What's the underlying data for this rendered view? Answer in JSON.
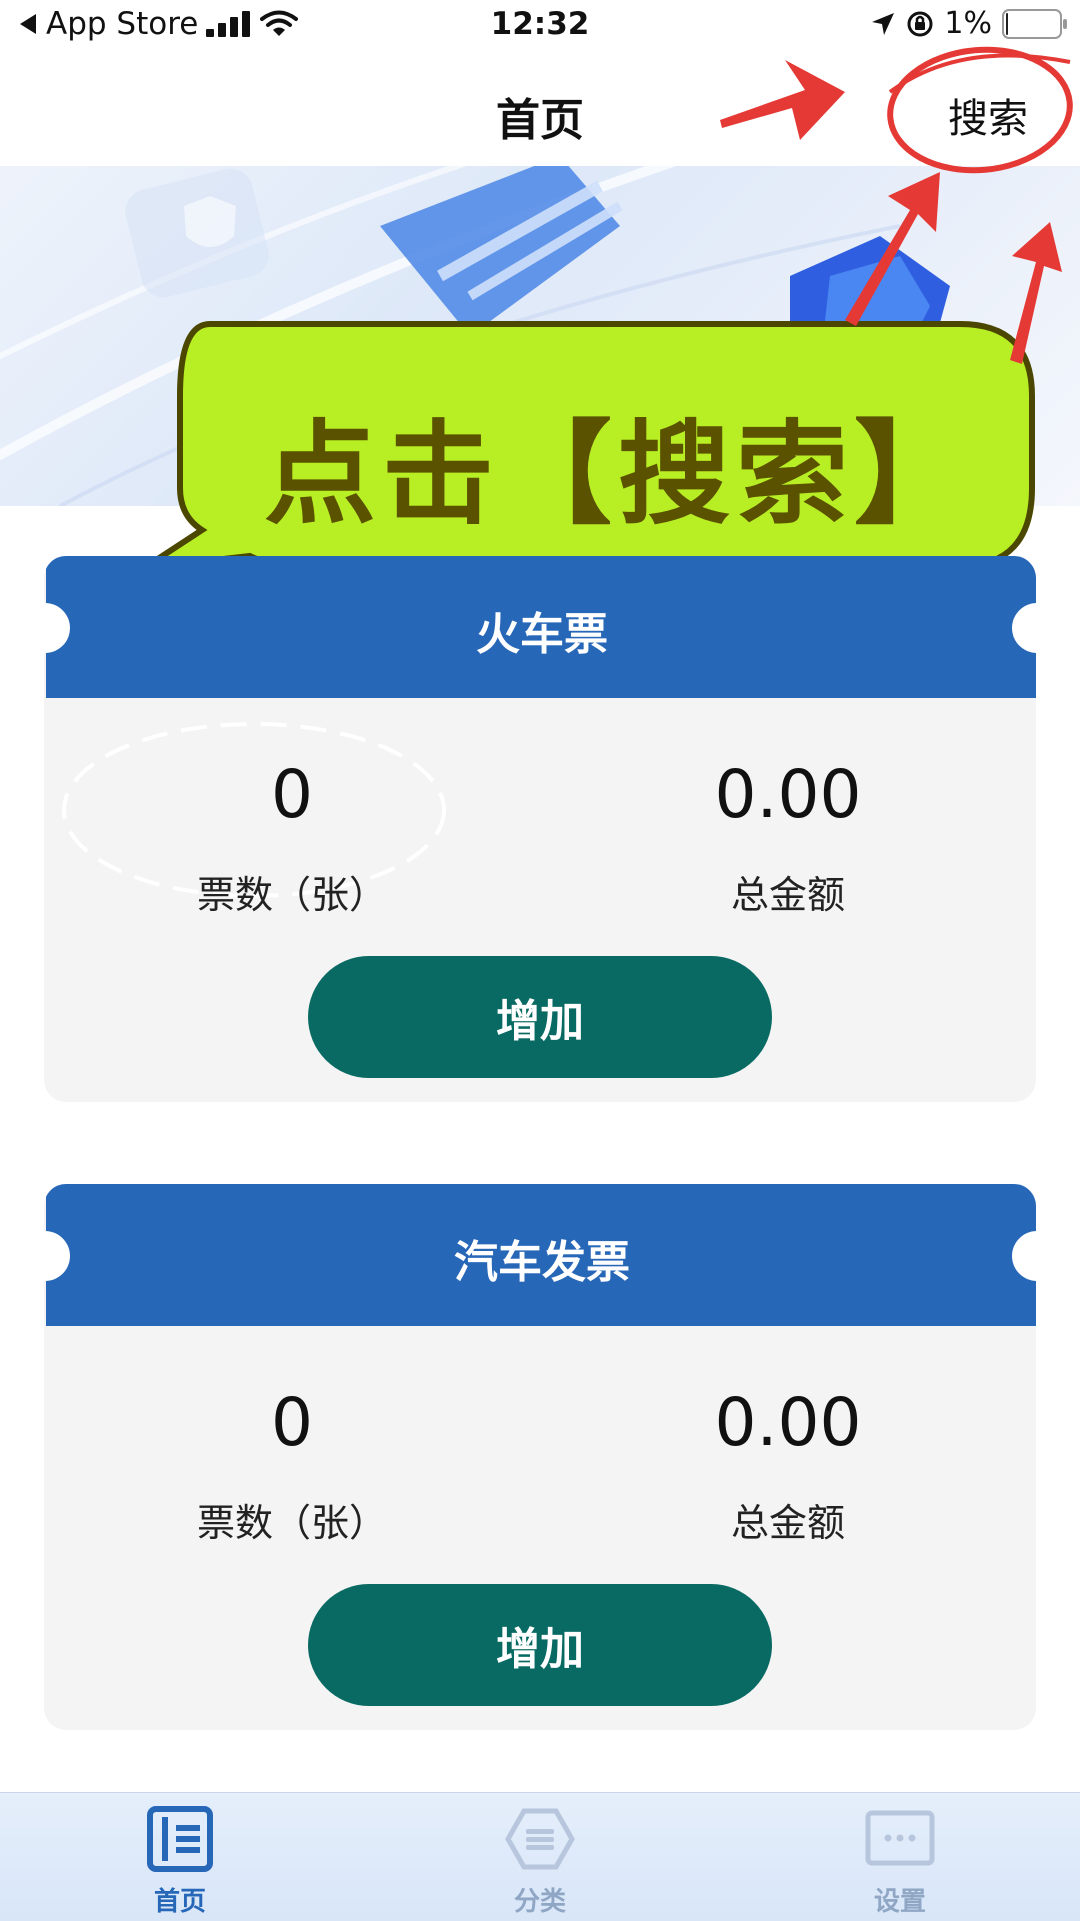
{
  "status_bar": {
    "back_app": "App Store",
    "time": "12:32",
    "battery_text": "1%",
    "battery_level": 0.01
  },
  "nav": {
    "title": "首页",
    "search_label": "搜索"
  },
  "annotation": {
    "callout_text": "点击【搜索】",
    "highlight_color": "#e53935",
    "callout_color": "#b8ef24"
  },
  "cards": [
    {
      "title": "火车票",
      "count_value": "0",
      "count_label": "票数（张）",
      "amount_value": "0.00",
      "amount_label": "总金额",
      "add_label": "增加"
    },
    {
      "title": "汽车发票",
      "count_value": "0",
      "count_label": "票数（张）",
      "amount_value": "0.00",
      "amount_label": "总金额",
      "add_label": "增加"
    }
  ],
  "tabs": [
    {
      "label": "首页",
      "icon": "home-book-icon",
      "active": true
    },
    {
      "label": "分类",
      "icon": "category-hexagon-icon",
      "active": false
    },
    {
      "label": "设置",
      "icon": "settings-dots-icon",
      "active": false
    }
  ],
  "colors": {
    "accent": "#2767b8",
    "button": "#086a62",
    "tab_active": "#2767b8",
    "tab_inactive": "#8fa6c4"
  }
}
